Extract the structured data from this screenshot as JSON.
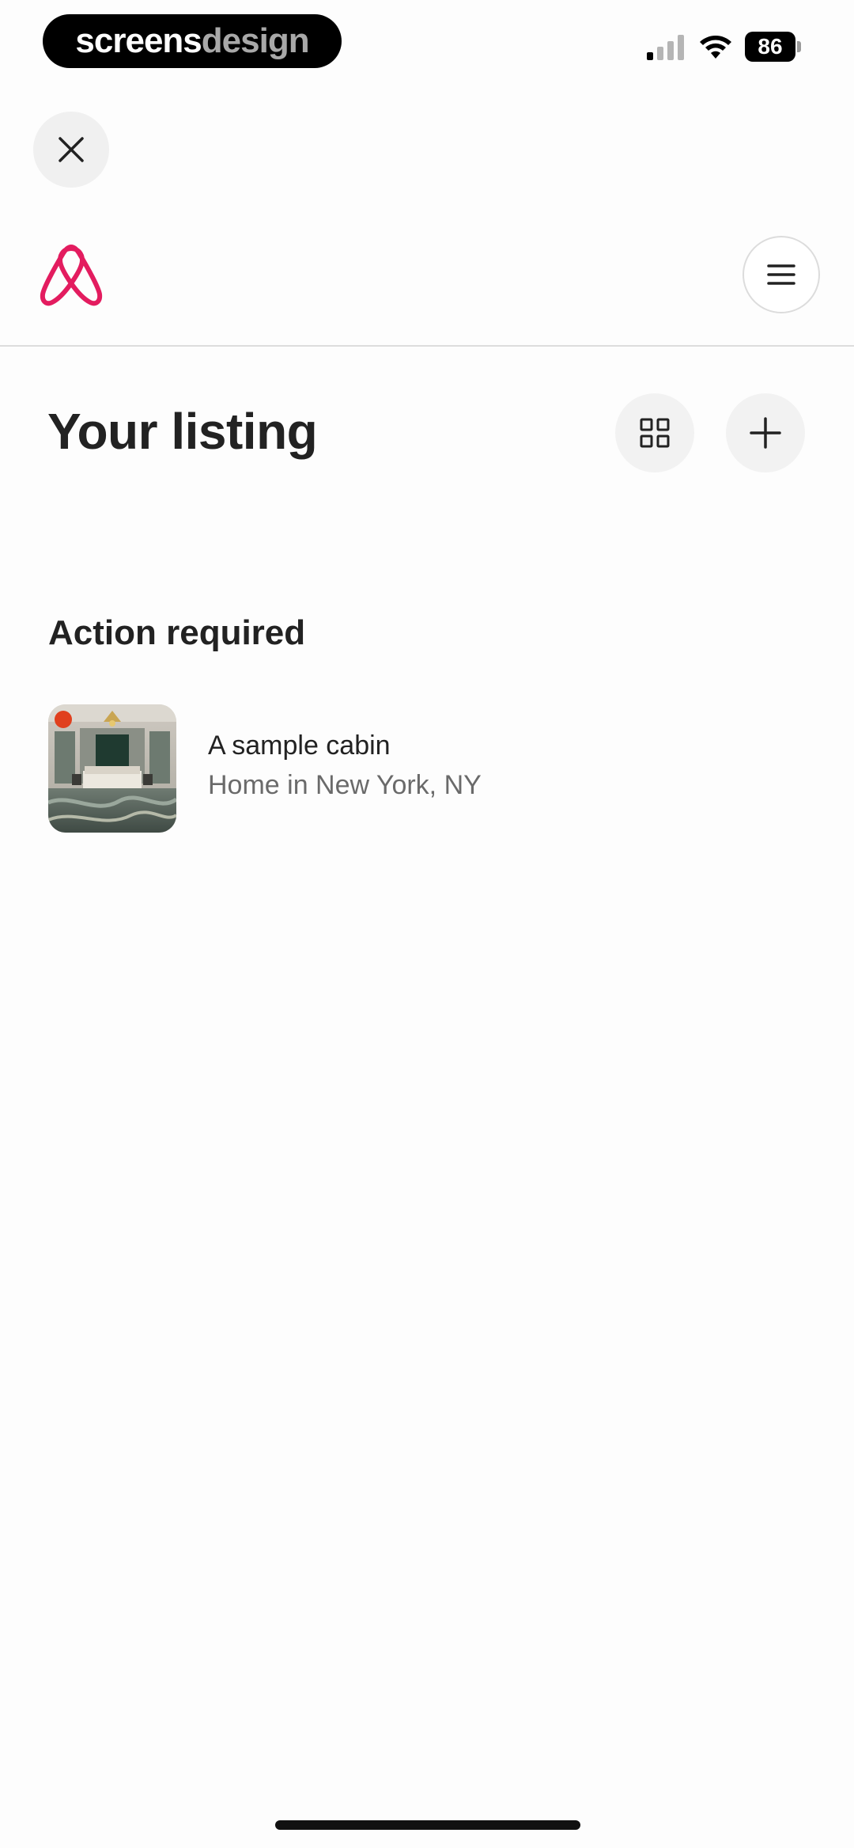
{
  "status_bar": {
    "brand_part1": "screens",
    "brand_part2": "design",
    "battery": "86",
    "icons": [
      "signal-icon",
      "wifi-icon",
      "battery-icon"
    ]
  },
  "toolbar": {
    "close_icon": "close-icon"
  },
  "header": {
    "logo_icon": "airbnb-logo-icon",
    "menu_icon": "hamburger-menu-icon",
    "accent_color": "#E31C5F"
  },
  "page": {
    "title": "Your listing",
    "grid_icon": "grid-icon",
    "add_icon": "plus-icon"
  },
  "section": {
    "title": "Action required",
    "items": [
      {
        "title": "A sample cabin",
        "subtitle": "Home in New York, NY",
        "status_dot_color": "#E0401E"
      }
    ]
  }
}
